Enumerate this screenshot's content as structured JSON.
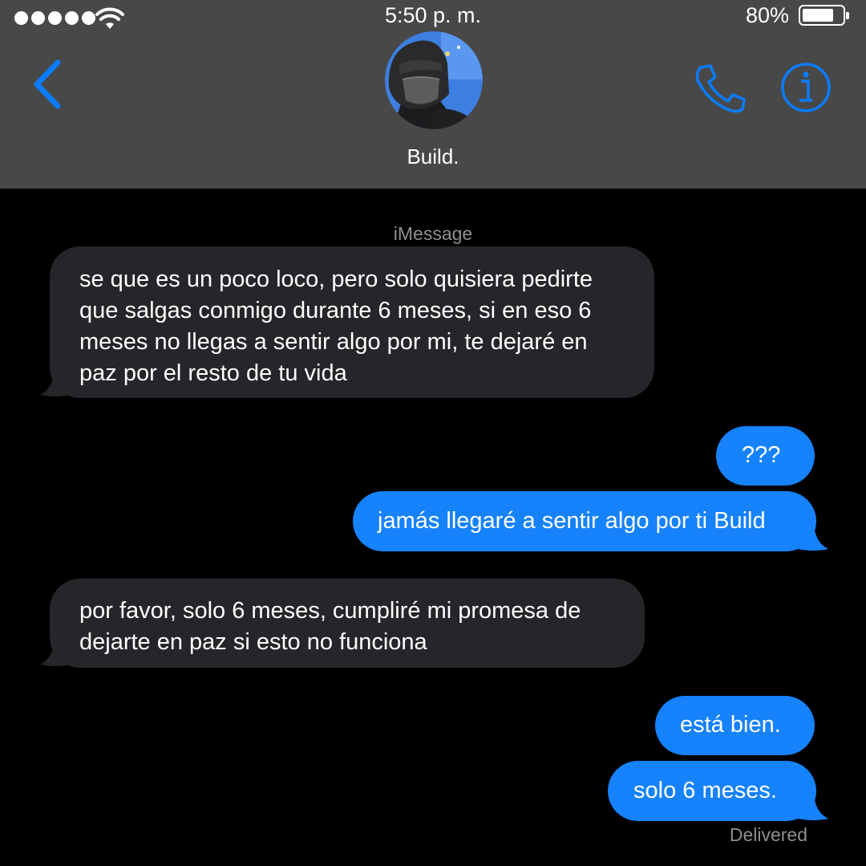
{
  "status_bar": {
    "time": "5:50 p. m.",
    "battery_percent": "80%",
    "battery_level": 0.8,
    "signal_bars": 5
  },
  "header": {
    "contact_name": "Build.",
    "back_icon": "chevron-left-icon",
    "call_icon": "phone-icon",
    "info_icon": "info-icon"
  },
  "conversation": {
    "service_label": "iMessage",
    "messages": [
      {
        "direction": "incoming",
        "text": "se que es un poco loco, pero solo quisiera pedirte\nque salgas conmigo durante 6 meses, si en eso 6\nmeses no llegas a sentir algo por mi, te dejaré en\npaz por el resto de tu vida"
      },
      {
        "direction": "outgoing",
        "text": "???"
      },
      {
        "direction": "outgoing",
        "text": "jamás llegaré a sentir algo por ti Build"
      },
      {
        "direction": "incoming",
        "text": "por favor, solo 6 meses, cumpliré mi promesa de\ndejarte en paz si esto no funciona"
      },
      {
        "direction": "outgoing",
        "text": "está bien."
      },
      {
        "direction": "outgoing",
        "text": "solo 6 meses."
      }
    ],
    "delivery_status": "Delivered"
  },
  "colors": {
    "header_background": "#484848",
    "background": "#000000",
    "incoming_bubble": "#262529",
    "outgoing_bubble": "#1682fb",
    "accent": "#0a7cff",
    "secondary_text": "#8e8e93"
  }
}
